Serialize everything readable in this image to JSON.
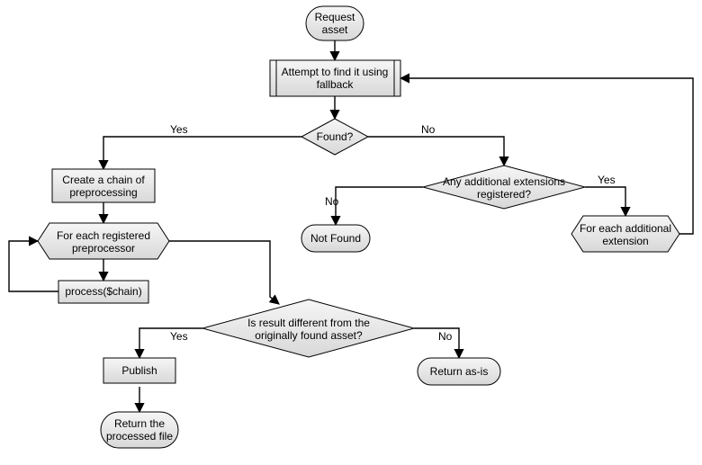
{
  "nodes": {
    "start": {
      "label1": "Request",
      "label2": "asset"
    },
    "attempt": {
      "label1": "Attempt to find it using",
      "label2": "fallback"
    },
    "found": {
      "label1": "Found?"
    },
    "anyext": {
      "label1": "Any additional extensions",
      "label2": "registered?"
    },
    "foreachext": {
      "label1": "For each additional",
      "label2": "extension"
    },
    "notfound": {
      "label1": "Not Found"
    },
    "createchain": {
      "label1": "Create a chain of",
      "label2": "preprocessing"
    },
    "foreachpre": {
      "label1": "For each registered",
      "label2": "preprocessor"
    },
    "processchain": {
      "label1": "process($chain)"
    },
    "isdiff": {
      "label1": "Is result different from the",
      "label2": "originally found asset?"
    },
    "publish": {
      "label1": "Publish"
    },
    "returnproc": {
      "label1": "Return the",
      "label2": "processed file"
    },
    "returnasis": {
      "label1": "Return as-is"
    }
  },
  "edges": {
    "found_yes": "Yes",
    "found_no": "No",
    "anyext_yes": "Yes",
    "anyext_no": "No",
    "isdiff_yes": "Yes",
    "isdiff_no": "No"
  }
}
